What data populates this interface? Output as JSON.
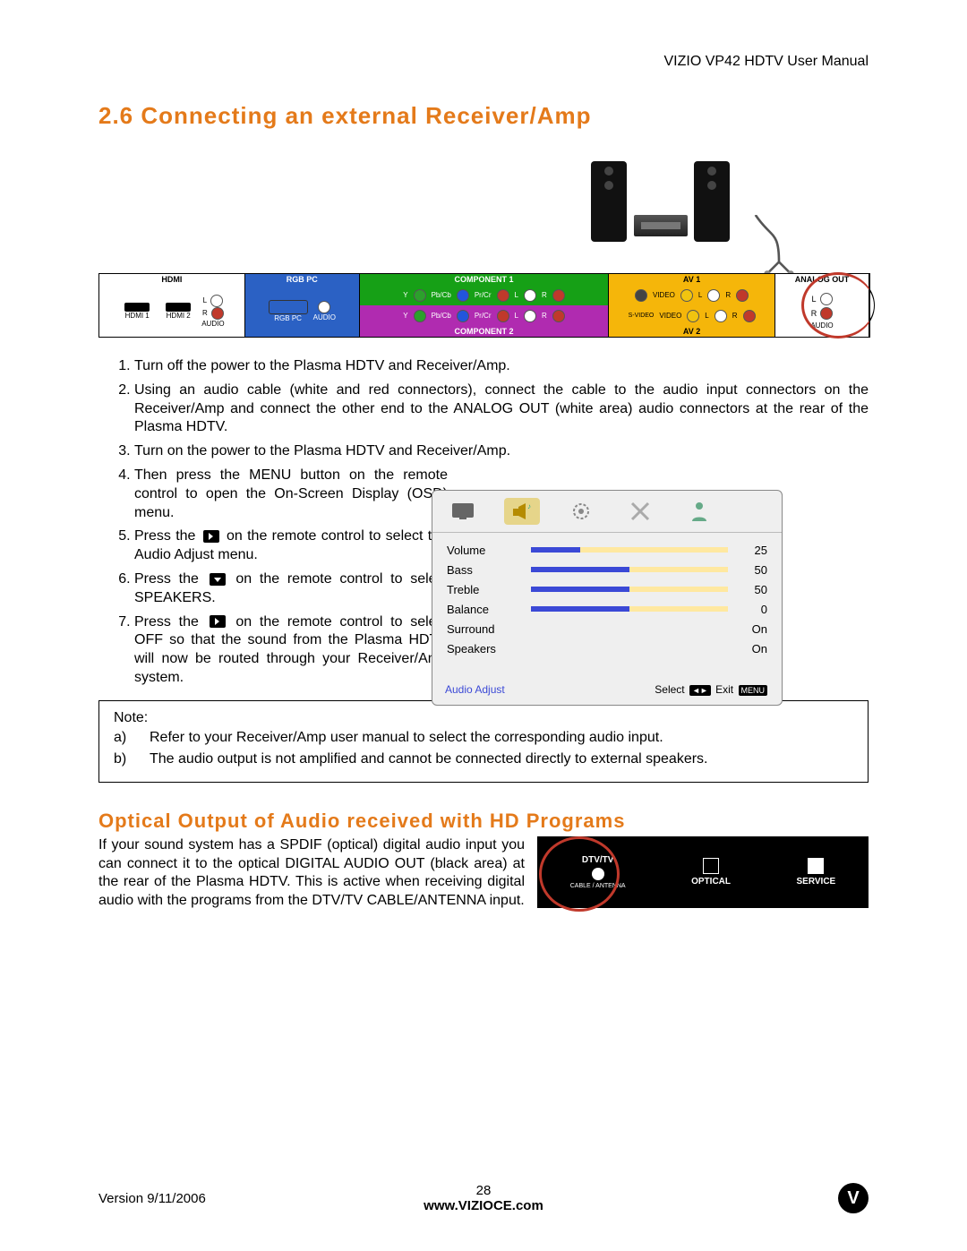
{
  "header_right": "VIZIO VP42 HDTV User Manual",
  "section_title": "2.6 Connecting an external Receiver/Amp",
  "rear_panel": {
    "sections": [
      {
        "bg": "#ffffff",
        "title": "HDMI"
      },
      {
        "bg": "#2b61c4",
        "title": "RGB PC"
      },
      {
        "bg": "#16a016",
        "title": "COMPONENT 1"
      },
      {
        "bg": "#b02bb0",
        "title": "COMPONENT 2"
      },
      {
        "bg": "#f5b60a",
        "title": "AV 1"
      },
      {
        "bg": "#f5b60a",
        "title": "AV 2"
      },
      {
        "bg": "#ffffff",
        "title": "ANALOG OUT"
      }
    ],
    "sub_labels": {
      "hdmi1": "HDMI 1",
      "hdmi2": "HDMI 2",
      "audio": "AUDIO",
      "rgbpc": "RGB PC",
      "svideo": "S-VIDEO",
      "video": "VIDEO",
      "L": "L",
      "R": "R",
      "Y": "Y",
      "Pb": "Pb/Cb",
      "Pr": "Pr/Cr"
    }
  },
  "steps": [
    "Turn off the power to the Plasma HDTV and Receiver/Amp.",
    "Using an audio cable (white and red connectors), connect the cable to the audio input connectors on the Receiver/Amp and connect the other end to the ANALOG OUT (white area) audio connectors at the rear of the Plasma HDTV.",
    "Turn on the power to the Plasma HDTV and Receiver/Amp.",
    "Then press the MENU button on the remote control to open the On-Screen Display (OSD) menu.",
    "Press the  on the remote control to select the Audio Adjust menu.",
    "Press the  on the remote control to select SPEAKERS.",
    "Press the  on the remote control to select OFF so that the sound from the Plasma HDTV will now be routed through your Receiver/Amp system."
  ],
  "step5_pre": "Press the ",
  "step5_post": " on the remote control to select the Audio Adjust menu.",
  "step6_pre": "Press the ",
  "step6_post": " on the remote control to select SPEAKERS.",
  "step7_pre": "Press the ",
  "step7_post": " on the remote control to select OFF so that the sound from the Plasma HDTV will now be routed through your Receiver/Amp system.",
  "osd": {
    "rows": [
      {
        "label": "Volume",
        "value": "25",
        "pct": 25
      },
      {
        "label": "Bass",
        "value": "50",
        "pct": 50
      },
      {
        "label": "Treble",
        "value": "50",
        "pct": 50
      },
      {
        "label": "Balance",
        "value": "0",
        "pct": 50
      },
      {
        "label": "Surround",
        "value": "On",
        "pct": null
      },
      {
        "label": "Speakers",
        "value": "On",
        "pct": null
      }
    ],
    "footer_left": "Audio Adjust",
    "footer_select": "Select",
    "footer_exit": "Exit",
    "footer_menu": "MENU"
  },
  "note": {
    "title": "Note:",
    "a_key": "a)",
    "a_text": "Refer to your Receiver/Amp user manual to select the corresponding audio input.",
    "b_key": "b)",
    "b_text": "The audio output is not amplified and cannot be connected directly to external speakers."
  },
  "optical": {
    "heading": "Optical Output of Audio received with HD Programs",
    "text": "If your sound system has a SPDIF (optical) digital audio input you can connect it to the optical DIGITAL AUDIO OUT (black area) at the rear of the Plasma HDTV.  This is active when receiving digital audio with the programs from the DTV/TV CABLE/ANTENNA input.",
    "panel": {
      "dtvtv": "DTV/TV",
      "cable": "CABLE / ANTENNA",
      "optical": "OPTICAL",
      "service": "SERVICE"
    }
  },
  "footer": {
    "version": "Version 9/11/2006",
    "page": "28",
    "url": "www.VIZIOCE.com",
    "logo": "V"
  }
}
